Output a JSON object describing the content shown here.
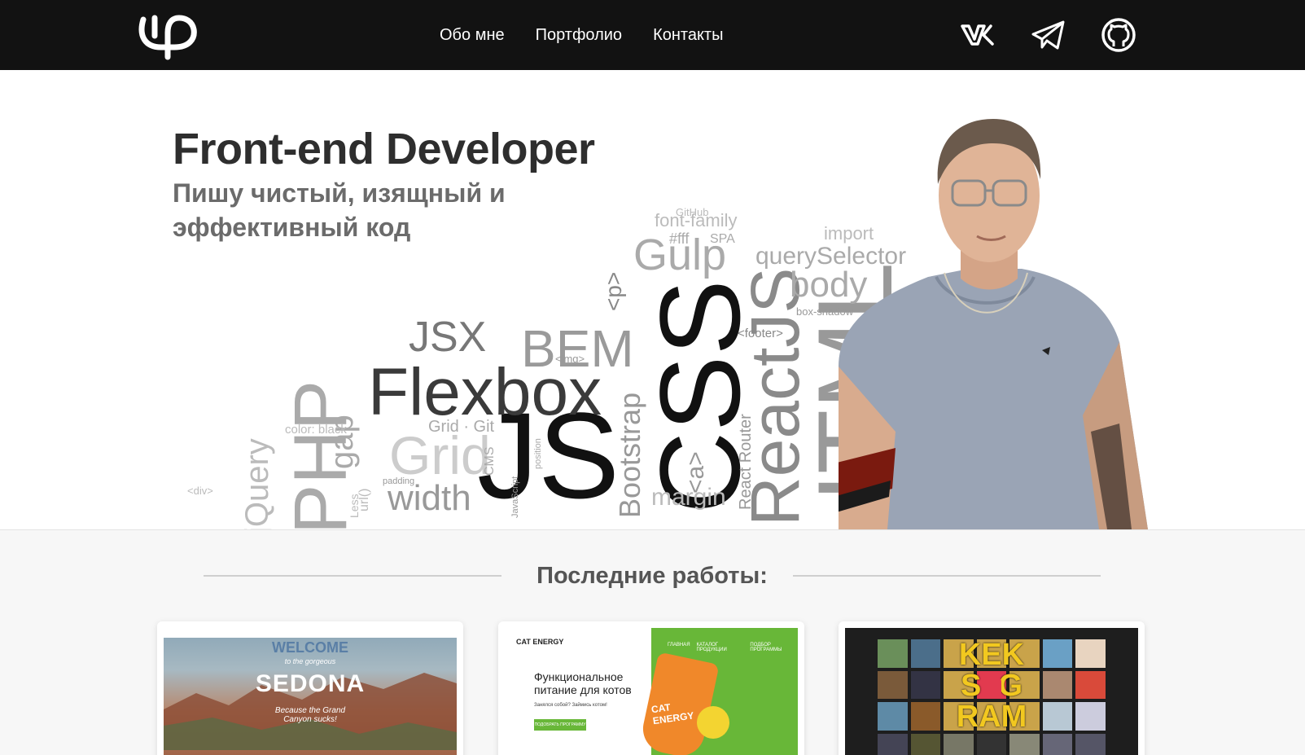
{
  "header": {
    "logo_icon": "phi-logo-icon",
    "nav": [
      {
        "label": "Обо мне"
      },
      {
        "label": "Портфолио"
      },
      {
        "label": "Контакты"
      }
    ],
    "social": [
      {
        "name": "vk-icon"
      },
      {
        "name": "telegram-icon"
      },
      {
        "name": "github-icon"
      }
    ]
  },
  "hero": {
    "title": "Front-end Developer",
    "subtitle": "Пишу чистый, изящный и эффективный код",
    "cloud_words": [
      "JS",
      "CSS",
      "Flexbox",
      "BEM",
      "JSX",
      "ReactJS",
      "HTML",
      "PHP",
      "Gulp",
      "Grid",
      "Bootstrap",
      "width",
      "gap",
      "jQuery",
      "body",
      "querySelector",
      "font-family",
      "margin",
      "import",
      "GitHub",
      "#fff",
      "SPA",
      "React Router",
      "box-shadow",
      "<footer>",
      "<p>",
      "<img>",
      "<div>",
      "<a>",
      "color: black",
      "padding",
      "CMS",
      "Less",
      "Grid · Git",
      "JavaScript",
      "position",
      "url()"
    ]
  },
  "works": {
    "title": "Последние работы:",
    "cards": [
      {
        "name": "sedona",
        "caption_top": "WELCOME",
        "caption_small": "to the gorgeous",
        "caption_main": "SEDONA",
        "caption_bottom": "Because the Grand Canyon sucks!"
      },
      {
        "name": "cat-energy",
        "brand": "CAT ENERGY",
        "nav": [
          "ГЛАВНАЯ",
          "КАТАЛОГ ПРОДУКЦИИ",
          "ПОДБОР ПРОГРАММЫ"
        ],
        "headline": "Функциональное питание для котов",
        "tagline": "Занялся собой? Займись котом!",
        "button": "ПОДОБРАТЬ ПРОГРАММУ",
        "product": "CAT ENERGY"
      },
      {
        "name": "kekstagram",
        "logo_top": "KEK",
        "logo_mid": "S  G",
        "logo_bottom": "RAM"
      }
    ]
  },
  "colors": {
    "header_bg": "#121212",
    "title": "#2e2e2e",
    "subtitle": "#6b6b6b",
    "cat_green": "#68b738",
    "kek_yellow": "#f2c81f"
  }
}
